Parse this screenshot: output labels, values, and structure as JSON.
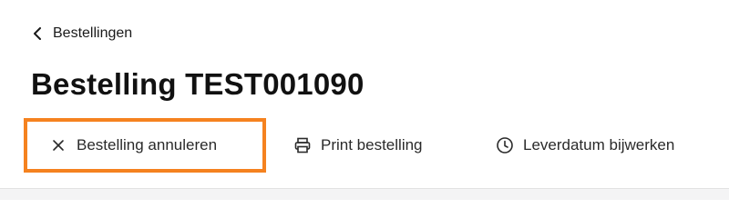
{
  "breadcrumb": {
    "label": "Bestellingen",
    "icon": "chevron-left-icon"
  },
  "page": {
    "title": "Bestelling TEST001090"
  },
  "actions": [
    {
      "label": "Bestelling annuleren",
      "icon": "close-icon"
    },
    {
      "label": "Print bestelling",
      "icon": "printer-icon"
    },
    {
      "label": "Leverdatum bijwerken",
      "icon": "clock-icon"
    }
  ],
  "colors": {
    "highlight": "#f5821f",
    "text": "#1a1a1a",
    "divider": "#e2e2e2"
  }
}
